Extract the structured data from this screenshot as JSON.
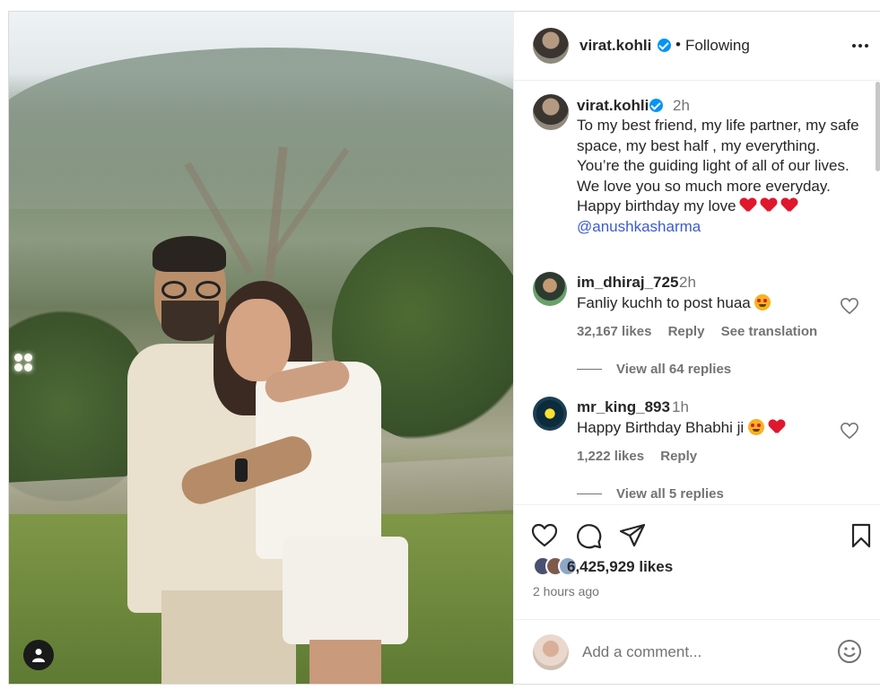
{
  "post": {
    "author": "virat.kohli",
    "follow_status": "Following",
    "separator": "•",
    "caption_time": "2h",
    "caption_line1": "To my best friend, my life partner, my safe space, my best half , my everything. You’re the guiding light of all of our lives. We love you so much more everyday. Happy birthday my love",
    "mention": "@anushkasharma",
    "likes": "6,425,929 likes",
    "time_ago": "2 hours ago"
  },
  "comments": [
    {
      "username": "im_dhiraj_725",
      "time": "2h",
      "text": "Fanliy kuchh to post huaa",
      "likes": "32,167 likes",
      "reply_label": "Reply",
      "translation_label": "See translation",
      "view_replies": "View all 64 replies"
    },
    {
      "username": "mr_king_893",
      "time": "1h",
      "text": "Happy Birthday Bhabhi ji",
      "likes": "1,222 likes",
      "reply_label": "Reply",
      "view_replies": "View all 5 replies"
    }
  ],
  "composer": {
    "placeholder": "Add a comment..."
  },
  "icons": {
    "more": "more-options-icon",
    "like": "heart-icon",
    "comment": "comment-icon",
    "share": "share-icon",
    "save": "bookmark-icon",
    "emoji": "emoji-icon",
    "tag": "user-tag-icon",
    "verified": "verified-icon"
  },
  "colors": {
    "verified": "#0095f6",
    "mention": "#3a5bd0",
    "muted": "#737373",
    "heart_emoji": "#e0182d"
  }
}
